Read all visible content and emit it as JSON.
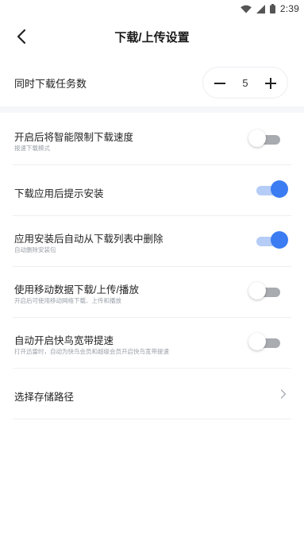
{
  "status_bar": {
    "time": "2:39",
    "icons": [
      "wifi-icon",
      "cell-signal-icon",
      "battery-icon"
    ]
  },
  "header": {
    "back_icon": "chevron-left-icon",
    "title": "下载/上传设置"
  },
  "concurrent_tasks": {
    "label": "同时下载任务数",
    "value": "5"
  },
  "settings": [
    {
      "title": "开启后将智能限制下载速度",
      "subtitle": "报速下载模式",
      "toggle_on": false
    },
    {
      "title": "下载应用后提示安装",
      "subtitle": "",
      "toggle_on": true
    },
    {
      "title": "应用安装后自动从下载列表中删除",
      "subtitle": "自动删除安装包",
      "toggle_on": true
    },
    {
      "title": "使用移动数据下载/上传/播放",
      "subtitle": "开启后可使用移动网络下载、上传和播放",
      "toggle_on": false
    },
    {
      "title": "自动开启快鸟宽带提速",
      "subtitle": "打开迅雷时，自动为快鸟会员和超级会员开启快鸟宽带提速",
      "toggle_on": false
    }
  ],
  "storage_path": {
    "label": "选择存储路径"
  },
  "colors": {
    "accent": "#3b7cf2",
    "accent_track": "#b5ccf7",
    "off_track": "#a8abb0",
    "band": "#f4f6f9"
  }
}
